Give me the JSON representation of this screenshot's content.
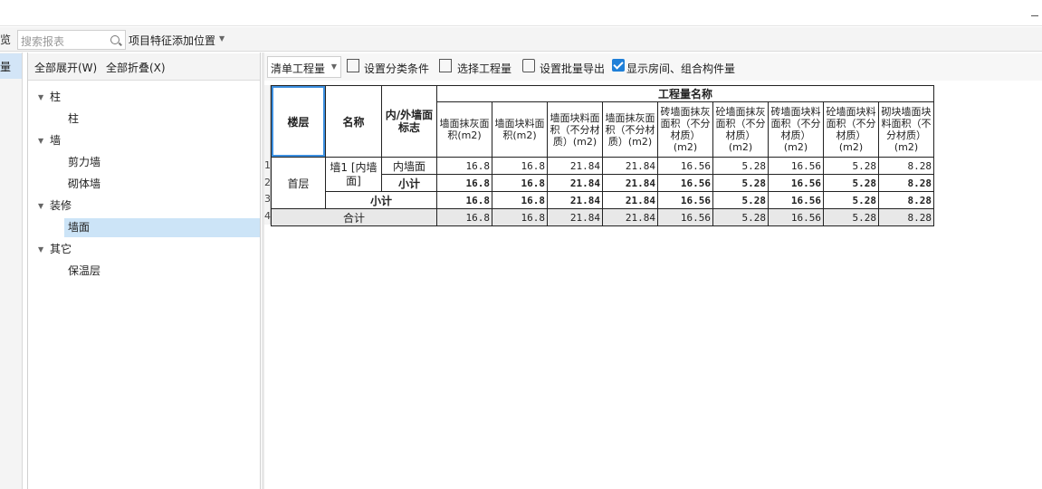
{
  "top": {
    "left_cut_1": "览",
    "search_placeholder": "搜索报表",
    "feature_position": "项目特征添加位置"
  },
  "left_strip": {
    "label": "量"
  },
  "tree": {
    "expand_all": "全部展开(W)",
    "collapse_all": "全部折叠(X)",
    "nodes": [
      {
        "label": "柱",
        "level": 0,
        "expanded": true
      },
      {
        "label": "柱",
        "level": 1
      },
      {
        "label": "墙",
        "level": 0,
        "expanded": true
      },
      {
        "label": "剪力墙",
        "level": 1
      },
      {
        "label": "砌体墙",
        "level": 1
      },
      {
        "label": "装修",
        "level": 0,
        "expanded": true
      },
      {
        "label": "墙面",
        "level": 1,
        "selected": true
      },
      {
        "label": "其它",
        "level": 0,
        "expanded": true
      },
      {
        "label": "保温层",
        "level": 1
      }
    ]
  },
  "toolbar": {
    "mode": "清单工程量",
    "set_category": "设置分类条件",
    "select_quantity": "选择工程量",
    "batch_export": "设置批量导出",
    "show_rooms": "显示房间、组合构件量",
    "show_rooms_checked": true
  },
  "table": {
    "row_numbers": [
      "1",
      "2",
      "3",
      "4"
    ],
    "header": {
      "floor": "楼层",
      "name": "名称",
      "inout": "内/外墙面标志",
      "group": "工程量名称",
      "columns": [
        "墙面抹灰面积(m2)",
        "墙面块料面积(m2)",
        "墙面块料面积（不分材质）(m2)",
        "墙面抹灰面积（不分材质）(m2)",
        "砖墙面抹灰面积（不分材质）(m2)",
        "砼墙面抹灰面积（不分材质）(m2)",
        "砖墙面块料面积（不分材质）(m2)",
        "砼墙面块料面积（不分材质）(m2)",
        "砌块墙面块料面积（不分材质）(m2)"
      ]
    },
    "floor_value": "首层",
    "name_value": "墙1 [内墙面]",
    "rows": [
      {
        "label": "内墙面",
        "values": [
          "16.8",
          "16.8",
          "21.84",
          "21.84",
          "16.56",
          "5.28",
          "16.56",
          "5.28",
          "8.28"
        ]
      },
      {
        "label": "小计",
        "values": [
          "16.8",
          "16.8",
          "21.84",
          "21.84",
          "16.56",
          "5.28",
          "16.56",
          "5.28",
          "8.28"
        ]
      },
      {
        "label": "小计",
        "values": [
          "16.8",
          "16.8",
          "21.84",
          "21.84",
          "16.56",
          "5.28",
          "16.56",
          "5.28",
          "8.28"
        ]
      },
      {
        "label": "合计",
        "values": [
          "16.8",
          "16.8",
          "21.84",
          "21.84",
          "16.56",
          "5.28",
          "16.56",
          "5.28",
          "8.28"
        ]
      }
    ]
  }
}
